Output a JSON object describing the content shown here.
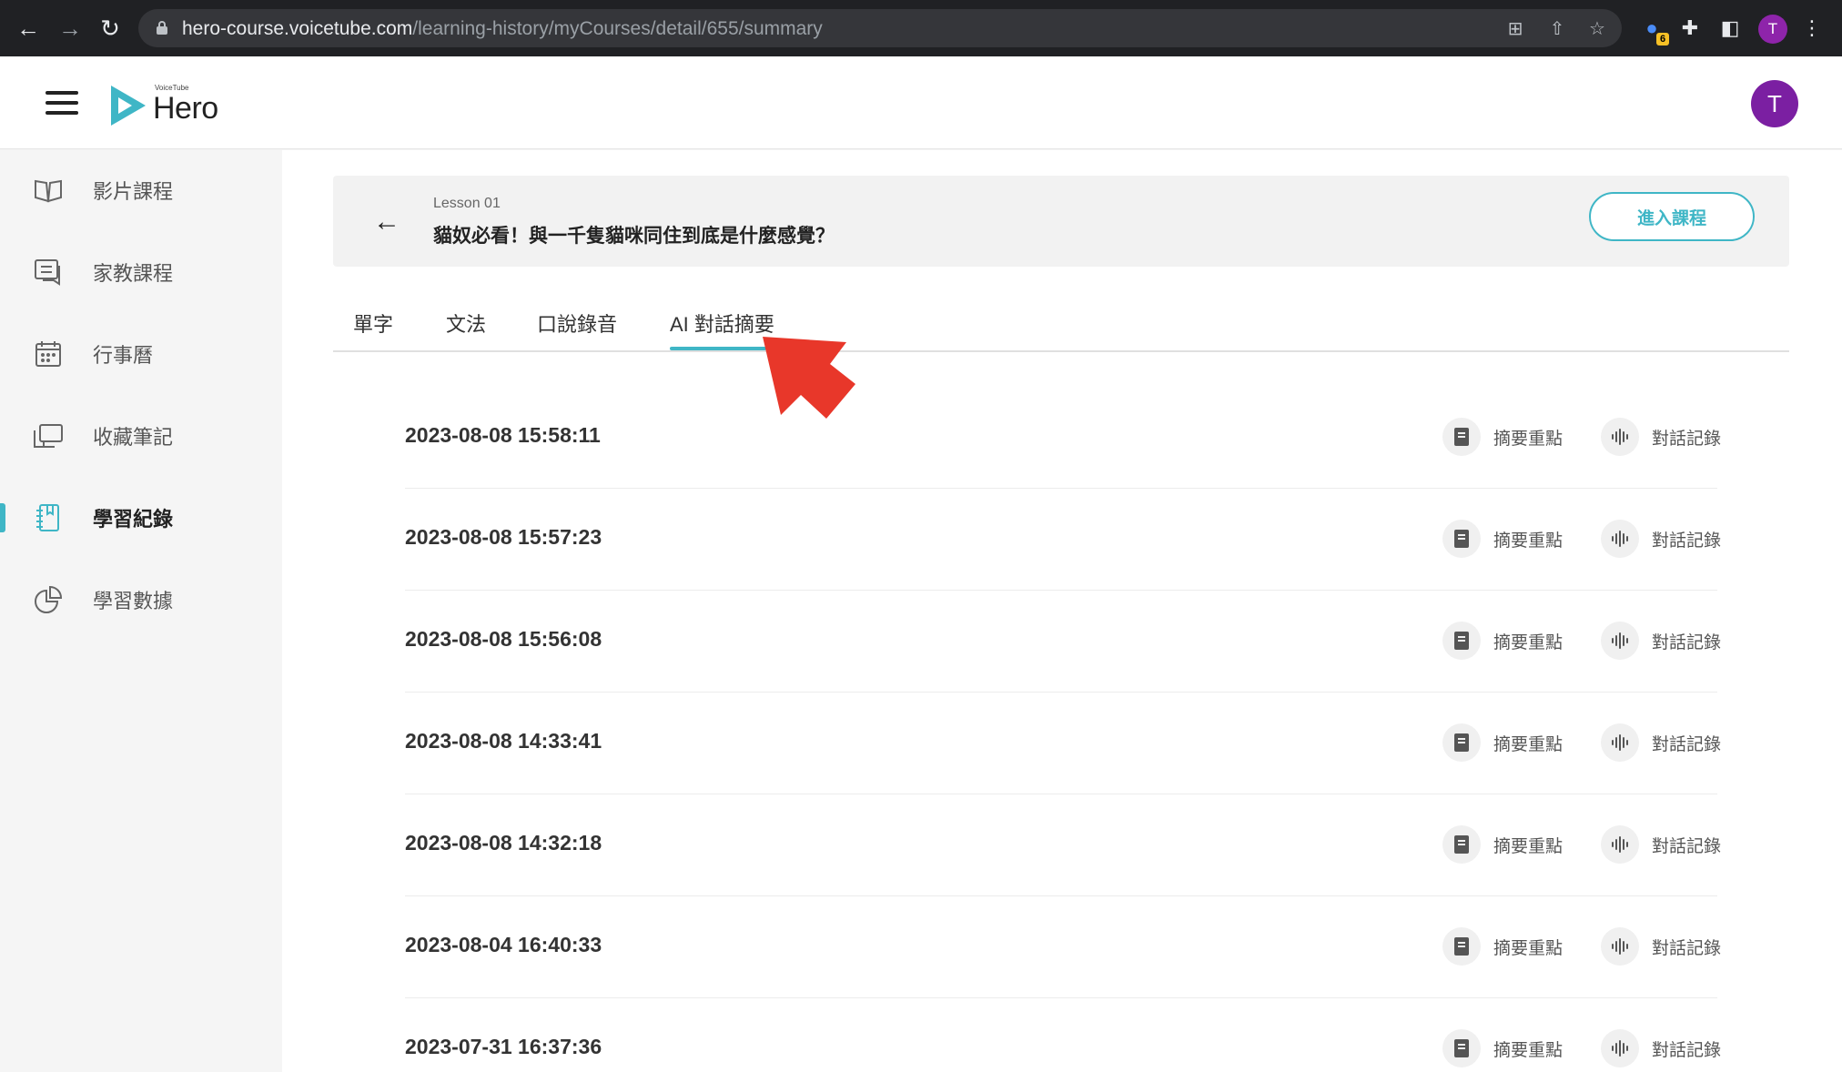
{
  "browser": {
    "url_host": "hero-course.voicetube.com",
    "url_path": "/learning-history/myCourses/detail/655/summary",
    "profile_initial": "T",
    "extension_badge": "6"
  },
  "header": {
    "logo_small": "VoiceTube",
    "logo_text": "Hero",
    "avatar_initial": "T"
  },
  "sidebar": {
    "items": [
      {
        "label": "影片課程",
        "icon": "book-open-icon"
      },
      {
        "label": "家教課程",
        "icon": "chat-icon"
      },
      {
        "label": "行事曆",
        "icon": "calendar-icon"
      },
      {
        "label": "收藏筆記",
        "icon": "bookmark-card-icon"
      },
      {
        "label": "學習紀錄",
        "icon": "notebook-icon"
      },
      {
        "label": "學習數據",
        "icon": "pie-chart-icon"
      }
    ],
    "active_index": 4
  },
  "lesson": {
    "number": "Lesson 01",
    "title": "貓奴必看！與一千隻貓咪同住到底是什麼感覺？",
    "enter_button": "進入課程"
  },
  "tabs": [
    "單字",
    "文法",
    "口說錄音",
    "AI 對話摘要"
  ],
  "active_tab": 3,
  "records": [
    {
      "datetime": "2023-08-08 15:58:11"
    },
    {
      "datetime": "2023-08-08 15:57:23"
    },
    {
      "datetime": "2023-08-08 15:56:08"
    },
    {
      "datetime": "2023-08-08 14:33:41"
    },
    {
      "datetime": "2023-08-08 14:32:18"
    },
    {
      "datetime": "2023-08-04 16:40:33"
    },
    {
      "datetime": "2023-07-31 16:37:36"
    }
  ],
  "record_actions": {
    "summary_label": "摘要重點",
    "transcript_label": "對話記錄"
  },
  "colors": {
    "accent": "#3fb6c6",
    "annotation_arrow": "#e8372a",
    "avatar": "#7b1fa2"
  }
}
